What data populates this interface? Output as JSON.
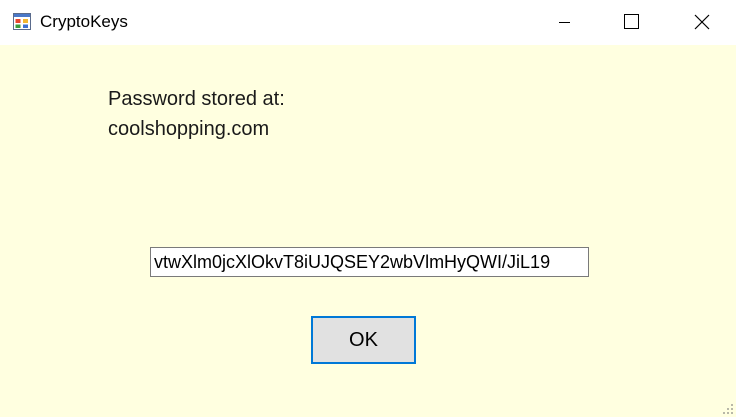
{
  "window": {
    "title": "CryptoKeys",
    "icon": "app-window-icon",
    "buttons": {
      "minimize": "minimize-icon",
      "maximize": "maximize-icon",
      "close": "close-icon"
    }
  },
  "dialog": {
    "message_line1": "Password stored at:",
    "message_line2": "coolshopping.com",
    "password_value": "vtwXlm0jcXlOkvT8iUJQSEY2wbVlmHyQWI/JiL19",
    "ok_label": "OK"
  },
  "colors": {
    "background": "#ffffe0",
    "titlebar": "#ffffff",
    "button_face": "#e1e1e1",
    "focus_border": "#0078d7"
  }
}
